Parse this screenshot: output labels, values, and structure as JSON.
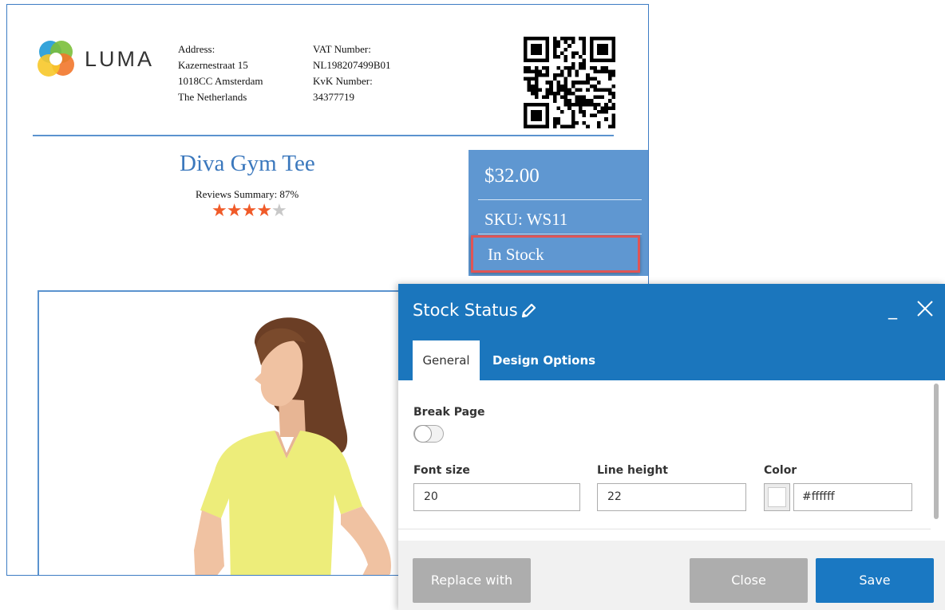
{
  "pdf": {
    "logo_text": "LUMA",
    "address": [
      "Address:",
      "Kazernestraat 15",
      "1018CC Amsterdam",
      "The Netherlands"
    ],
    "vat": [
      "VAT Number:",
      "NL198207499B01",
      "KvK Number:",
      "34377719"
    ],
    "product_title": "Diva Gym Tee",
    "reviews_summary": "Reviews Summary: 87%",
    "rating_stars": 4.35,
    "price": "$32.00",
    "sku": "SKU: WS11",
    "stock_status": "In Stock"
  },
  "modal": {
    "title": "Stock Status",
    "minimize_label": "_",
    "tabs": [
      {
        "label": "General",
        "active": true
      },
      {
        "label": "Design Options",
        "active": false
      }
    ],
    "break_page_label": "Break Page",
    "break_page_enabled": false,
    "font_size_label": "Font size",
    "font_size_value": "20",
    "line_height_label": "Line height",
    "line_height_value": "22",
    "color_label": "Color",
    "color_value": "#ffffff",
    "buttons": {
      "replace": "Replace with",
      "close": "Close",
      "save": "Save"
    }
  },
  "colors": {
    "header_blue": "#1b76bd",
    "price_box_blue": "#5f97d1",
    "title_blue": "#3b78bd",
    "highlight_red": "#e05555",
    "star_orange": "#f05a28"
  },
  "icons": [
    "luma-logo-icon",
    "qr-code-icon",
    "pencil-icon",
    "close-icon"
  ]
}
